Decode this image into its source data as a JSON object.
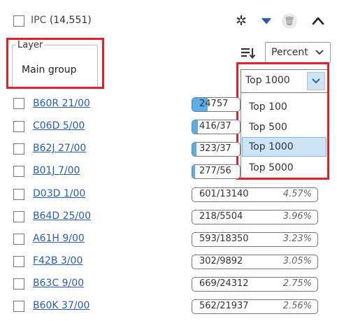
{
  "header": {
    "title": "IPC",
    "count": "(14,551)",
    "icons": [
      "gear-icon",
      "caret-down-icon",
      "trash-icon",
      "chevron-up-icon"
    ]
  },
  "layer": {
    "legend": "Layer",
    "value": "Main group"
  },
  "sort": {
    "icon": "sort-icon",
    "mode": "Percent"
  },
  "top_select": {
    "selected": "Top 1000",
    "options": [
      "Top 100",
      "Top 500",
      "Top 1000",
      "Top 5000"
    ]
  },
  "rows": [
    {
      "code": "B60R 21/00",
      "ratio": "24757",
      "pct": "",
      "fill": 0.5
    },
    {
      "code": "C06D 5/00",
      "ratio": "416/37",
      "pct": "",
      "fill": 0.05
    },
    {
      "code": "B62J 27/00",
      "ratio": "323/37",
      "pct": "",
      "fill": 0.04
    },
    {
      "code": "B01J 7/00",
      "ratio": "277/56",
      "pct": "",
      "fill": 0.02
    },
    {
      "code": "D03D 1/00",
      "ratio": "601/13140",
      "pct": "4.57%",
      "fill": 0.0
    },
    {
      "code": "B64D 25/00",
      "ratio": "218/5504",
      "pct": "3.96%",
      "fill": 0.0
    },
    {
      "code": "A61H 9/00",
      "ratio": "593/18350",
      "pct": "3.23%",
      "fill": 0.0
    },
    {
      "code": "F42B 3/00",
      "ratio": "302/9892",
      "pct": "3.05%",
      "fill": 0.0
    },
    {
      "code": "B63C 9/00",
      "ratio": "669/24312",
      "pct": "2.75%",
      "fill": 0.0
    },
    {
      "code": "B60K 37/00",
      "ratio": "562/21937",
      "pct": "2.56%",
      "fill": 0.0
    }
  ],
  "colors": {
    "accent": "#5aaee6",
    "highlight": "#e0202a",
    "link": "#2a5cab",
    "selected_option": "#cde4f7"
  }
}
